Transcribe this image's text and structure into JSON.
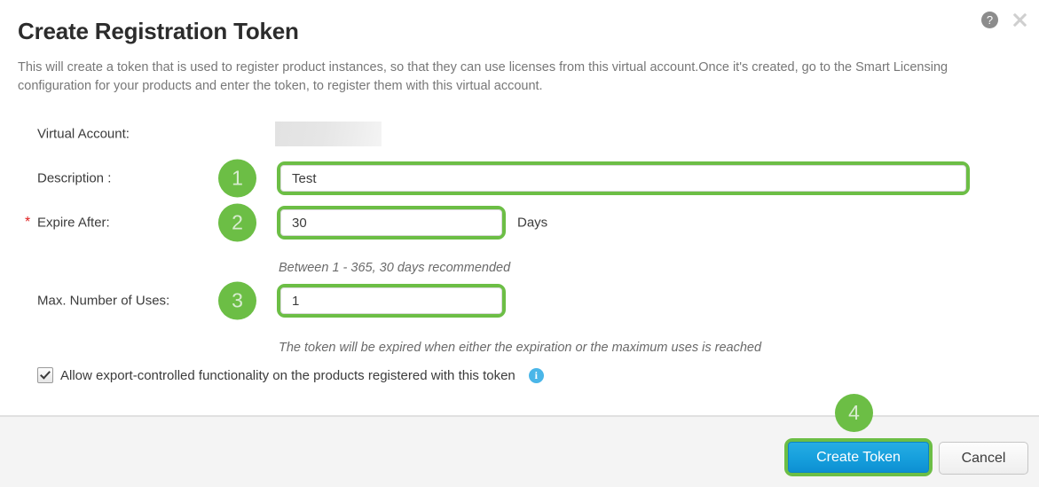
{
  "dialog": {
    "title": "Create Registration Token",
    "description": "This will create a token that is used to register product instances, so that they can use licenses from this virtual account.Once it's created, go to the Smart Licensing configuration for your products and enter the token, to register them with this virtual account.",
    "help_icon": "?",
    "close_icon": "×"
  },
  "form": {
    "virtual_account": {
      "label": "Virtual Account:",
      "value": ""
    },
    "description_field": {
      "label": "Description :",
      "value": "Test",
      "placeholder": "",
      "step": "1"
    },
    "expire_after": {
      "label": "Expire After:",
      "required_marker": "*",
      "value": "30",
      "suffix": "Days",
      "hint": "Between 1 - 365, 30 days recommended",
      "step": "2"
    },
    "max_uses": {
      "label": "Max. Number of Uses:",
      "value": "1",
      "hint": "The token will be expired when either the expiration or the maximum uses is reached",
      "step": "3"
    },
    "export_controlled": {
      "label": "Allow export-controlled functionality on the products registered with this token",
      "checked": true,
      "info_icon": "i"
    }
  },
  "footer": {
    "create_label": "Create Token",
    "cancel_label": "Cancel",
    "step": "4"
  },
  "colors": {
    "accent_green": "#6cbe45",
    "primary_blue": "#17a0dd",
    "required_red": "#e02020",
    "info_blue": "#4ab6e8"
  }
}
